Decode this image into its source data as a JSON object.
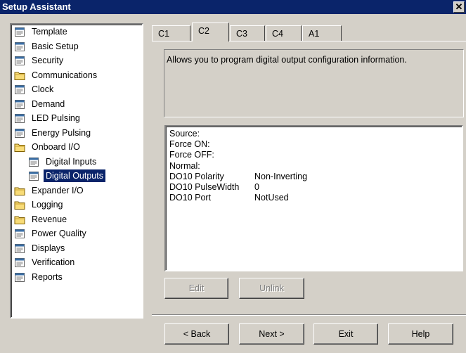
{
  "window": {
    "title": "Setup Assistant"
  },
  "tree": {
    "items": [
      {
        "label": "Template",
        "icon": "document-icon",
        "selected": false
      },
      {
        "label": "Basic Setup",
        "icon": "document-icon",
        "selected": false
      },
      {
        "label": "Security",
        "icon": "document-icon",
        "selected": false
      },
      {
        "label": "Communications",
        "icon": "folder-icon",
        "selected": false
      },
      {
        "label": "Clock",
        "icon": "document-icon",
        "selected": false
      },
      {
        "label": "Demand",
        "icon": "document-icon",
        "selected": false
      },
      {
        "label": "LED Pulsing",
        "icon": "document-icon",
        "selected": false
      },
      {
        "label": "Energy Pulsing",
        "icon": "document-icon",
        "selected": false
      },
      {
        "label": "Onboard I/O",
        "icon": "folder-open-icon",
        "selected": false
      },
      {
        "label": "Digital Inputs",
        "icon": "document-icon",
        "selected": false
      },
      {
        "label": "Digital Outputs",
        "icon": "document-icon",
        "selected": true
      },
      {
        "label": "Expander I/O",
        "icon": "folder-icon",
        "selected": false
      },
      {
        "label": "Logging",
        "icon": "folder-icon",
        "selected": false
      },
      {
        "label": "Revenue",
        "icon": "folder-icon",
        "selected": false
      },
      {
        "label": "Power Quality",
        "icon": "document-icon",
        "selected": false
      },
      {
        "label": "Displays",
        "icon": "document-icon",
        "selected": false
      },
      {
        "label": "Verification",
        "icon": "document-icon",
        "selected": false
      },
      {
        "label": "Reports",
        "icon": "document-icon",
        "selected": false
      }
    ]
  },
  "tabs": [
    {
      "label": "C1",
      "active": false
    },
    {
      "label": "C2",
      "active": true
    },
    {
      "label": "C3",
      "active": false
    },
    {
      "label": "C4",
      "active": false
    },
    {
      "label": "A1",
      "active": false
    }
  ],
  "description": "Allows you to program digital output configuration information.",
  "details": {
    "rows": [
      {
        "label": "Source:",
        "value": ""
      },
      {
        "label": "Force ON:",
        "value": ""
      },
      {
        "label": "Force OFF:",
        "value": ""
      },
      {
        "label": "Normal:",
        "value": ""
      },
      {
        "label": "DO10 Polarity",
        "value": "Non-Inverting"
      },
      {
        "label": "DO10 PulseWidth",
        "value": "0"
      },
      {
        "label": "DO10 Port",
        "value": "NotUsed"
      }
    ]
  },
  "actions": {
    "edit": "Edit",
    "unlink": "Unlink"
  },
  "footer": {
    "back": "< Back",
    "next": "Next >",
    "exit": "Exit",
    "help": "Help"
  },
  "colors": {
    "face": "#d4d0c8",
    "title_bar": "#0a246a",
    "selection": "#0a246a",
    "folder": "#f8dc78"
  }
}
